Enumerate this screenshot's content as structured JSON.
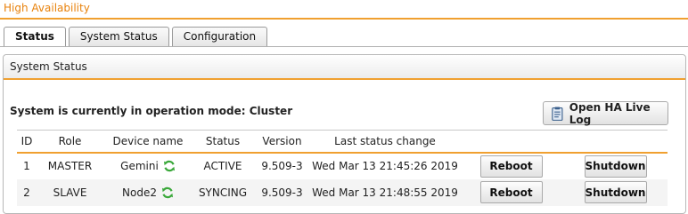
{
  "header": {
    "title": "High Availability"
  },
  "tabs": [
    {
      "label": "Status",
      "active": true
    },
    {
      "label": "System Status",
      "active": false
    },
    {
      "label": "Configuration",
      "active": false
    }
  ],
  "panel": {
    "title": "System Status",
    "mode_text": "System is currently in operation mode: Cluster",
    "live_log_label": "Open HA Live Log"
  },
  "table": {
    "headers": [
      "ID",
      "Role",
      "Device name",
      "Status",
      "Version",
      "Last status change"
    ],
    "rows": [
      {
        "id": "1",
        "role": "MASTER",
        "device": "Gemini",
        "status": "ACTIVE",
        "version": "9.509-3",
        "last_change": "Wed Mar 13 21:45:26 2019",
        "reboot": "Reboot",
        "shutdown": "Shutdown"
      },
      {
        "id": "2",
        "role": "SLAVE",
        "device": "Node2",
        "status": "SYNCING",
        "version": "9.509-3",
        "last_change": "Wed Mar 13 21:48:55 2019",
        "reboot": "Reboot",
        "shutdown": "Shutdown"
      }
    ]
  },
  "colors": {
    "accent": "#f0a030",
    "title": "#e8820c",
    "refresh_icon": "#3aa83a"
  },
  "icons": {
    "refresh": "refresh-icon",
    "log": "log-file-icon"
  }
}
